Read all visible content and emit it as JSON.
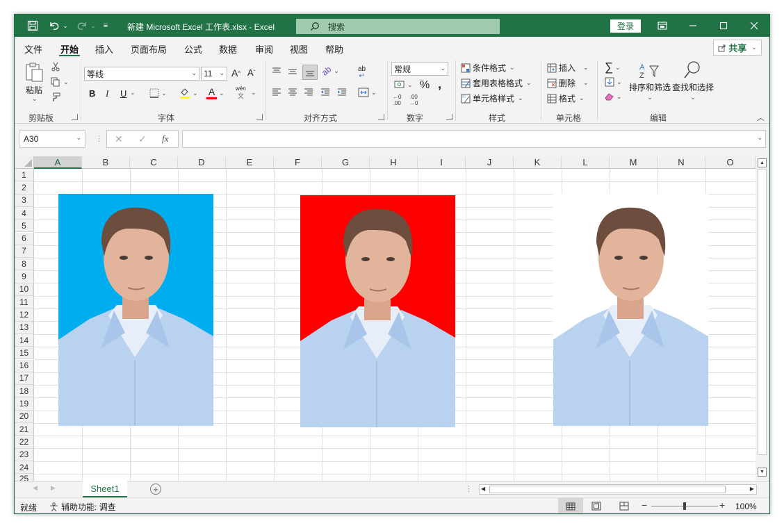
{
  "titlebar": {
    "title": "新建 Microsoft Excel 工作表.xlsx  -  Excel",
    "search_placeholder": "搜索",
    "login": "登录"
  },
  "menu": {
    "items": [
      "文件",
      "开始",
      "插入",
      "页面布局",
      "公式",
      "数据",
      "审阅",
      "视图",
      "帮助"
    ],
    "active": "开始",
    "share": "共享"
  },
  "ribbon": {
    "clipboard": {
      "label": "剪贴板",
      "paste": "粘贴"
    },
    "font": {
      "label": "字体",
      "font_name": "等线",
      "font_size": "11",
      "phonetic": "wén"
    },
    "alignment": {
      "label": "对齐方式"
    },
    "number": {
      "label": "数字",
      "format": "常规"
    },
    "styles": {
      "label": "样式",
      "conditional": "条件格式",
      "table": "套用表格格式",
      "cell": "单元格样式"
    },
    "cells": {
      "label": "单元格",
      "insert": "插入",
      "delete": "删除",
      "format": "格式"
    },
    "editing": {
      "label": "编辑",
      "sort": "排序和筛选",
      "find": "查找和选择"
    }
  },
  "formula_bar": {
    "name_box": "A30",
    "formula": ""
  },
  "grid": {
    "columns": [
      "A",
      "B",
      "C",
      "D",
      "E",
      "F",
      "G",
      "H",
      "I",
      "J",
      "K",
      "L",
      "M",
      "N",
      "O"
    ],
    "rows": [
      "1",
      "2",
      "3",
      "4",
      "5",
      "6",
      "7",
      "8",
      "9",
      "10",
      "11",
      "12",
      "13",
      "14",
      "15",
      "16",
      "17",
      "18",
      "19",
      "20",
      "21",
      "22",
      "23",
      "24",
      "25"
    ],
    "selected_column": "A"
  },
  "photos": [
    {
      "name": "blue-background-photo",
      "background": "#00adef"
    },
    {
      "name": "red-background-photo",
      "background": "#fe0000"
    },
    {
      "name": "white-background-photo",
      "background": "#ffffff"
    }
  ],
  "sheets": {
    "tabs": [
      "Sheet1"
    ],
    "active": "Sheet1"
  },
  "status": {
    "ready": "就绪",
    "accessibility": "辅助功能: 调查",
    "zoom": "100%"
  },
  "colors": {
    "accent": "#217346"
  }
}
